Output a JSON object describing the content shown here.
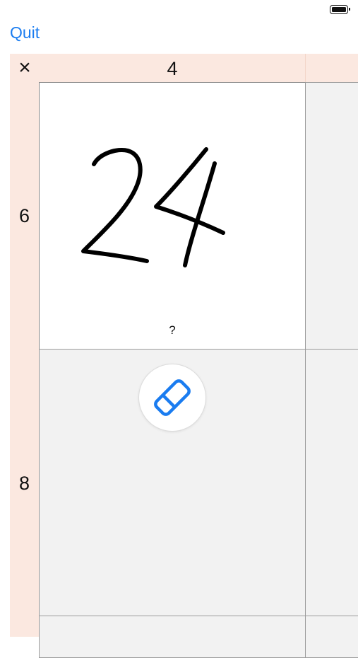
{
  "status_bar": {
    "battery_icon": "battery-full-icon"
  },
  "nav": {
    "quit_label": "Quit"
  },
  "table": {
    "operation_symbol": "×",
    "column_headers": [
      "4",
      ""
    ],
    "row_headers": [
      "6",
      "8"
    ]
  },
  "active_cell": {
    "handwritten_answer": "24",
    "hint": "?"
  },
  "eraser": {
    "icon": "eraser-icon"
  },
  "colors": {
    "accent": "#1a7cf0",
    "header_bg": "#fbe8e0",
    "empty_cell_bg": "#f2f2f2"
  }
}
